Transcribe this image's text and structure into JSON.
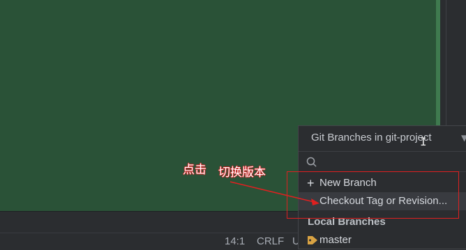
{
  "popup": {
    "title": "Git Branches in git-project",
    "search_placeholder": "",
    "actions": [
      {
        "label": "New Branch",
        "icon": "plus-icon"
      },
      {
        "label": "Checkout Tag or Revision..."
      }
    ],
    "section_local": "Local Branches",
    "branches": [
      {
        "label": "master",
        "icon": "tag-icon"
      }
    ]
  },
  "status_bar": {
    "position": "14:1",
    "line_separator": "CRLF",
    "encoding": "U"
  },
  "annotation": {
    "click_text": "点击",
    "switch_text": "切换版本"
  },
  "colors": {
    "editor_bg": "#2a5237",
    "ide_bg": "#2b2d30",
    "highlight": "#e02020",
    "tag_icon": "#d9a343"
  }
}
